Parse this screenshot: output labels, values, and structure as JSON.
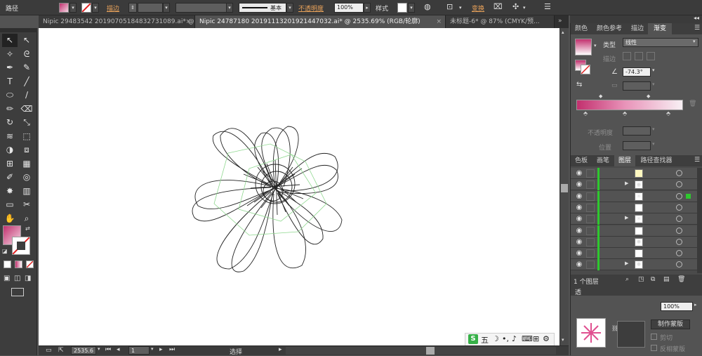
{
  "control_bar": {
    "object_type": "路径",
    "stroke_label": "描边",
    "stroke_weight_value": "",
    "brush_label": "基本",
    "opacity_label": "不透明度",
    "opacity_value": "100%",
    "style_label": "样式",
    "transform_label": "变换"
  },
  "tabs": [
    {
      "label": "Nipic 29483542 20190705184832731089.ai* @ ..."
    },
    {
      "label": "Nipic 24787180 20191113201921447032.ai* @ 2535.69% (RGB/轮廓)"
    },
    {
      "label": "未标题-6* @ 87% (CMYK/预..."
    }
  ],
  "toolbar": {
    "tools": [
      "selection-tool",
      "direct-selection-tool",
      "magic-wand-tool",
      "lasso-tool",
      "pen-tool",
      "curvature-tool",
      "type-tool",
      "line-tool",
      "ellipse-tool",
      "paintbrush-tool",
      "pencil-tool",
      "eraser-tool",
      "rotate-tool",
      "scale-tool",
      "width-tool",
      "free-transform-tool",
      "shape-builder-tool",
      "perspective-tool",
      "mesh-tool",
      "gradient-tool",
      "eyedropper-tool",
      "blend-tool",
      "symbol-sprayer-tool",
      "column-graph-tool",
      "artboard-tool",
      "slice-tool",
      "hand-tool",
      "zoom-tool"
    ]
  },
  "gradient_panel": {
    "tabs": [
      "颜色",
      "颜色参考",
      "描边",
      "渐变"
    ],
    "type_label": "类型",
    "type_value": "线性",
    "stroke_label": "描边",
    "angle_value": "-74.3°",
    "opacity_label": "不透明度",
    "location_label": "位置",
    "start_color": "#c2306e",
    "end_color": "#f8f0f4"
  },
  "layers_panel": {
    "tabs": [
      "色板",
      "画笔",
      "图层",
      "路径查找器"
    ],
    "layer_count": "1 个图层",
    "rows": [
      {
        "thumb": ""
      },
      {
        "thumb": "◉"
      },
      {
        "thumb": "✳"
      },
      {
        "thumb": ""
      },
      {
        "thumb": "✳"
      },
      {
        "thumb": ""
      },
      {
        "thumb": "✺"
      },
      {
        "thumb": ""
      },
      {
        "thumb": "✺"
      }
    ]
  },
  "bottom_panel": {
    "tab": "透",
    "opacity_value": "100%",
    "make_mask_label": "制作蒙版",
    "clip_label": "剪切",
    "invert_mask_label": "反相蒙版"
  },
  "status_bar": {
    "zoom_value": "2535.6",
    "artboard_value": "1",
    "tool_name": "选择"
  },
  "ime": {
    "logo": "S",
    "mode": "五"
  },
  "colors": {
    "fill_gradient_start": "#c2306e",
    "fill_gradient_end": "#f4d4e2",
    "layer_color": "#2ec82e",
    "accent_orange": "#e8a25a"
  }
}
